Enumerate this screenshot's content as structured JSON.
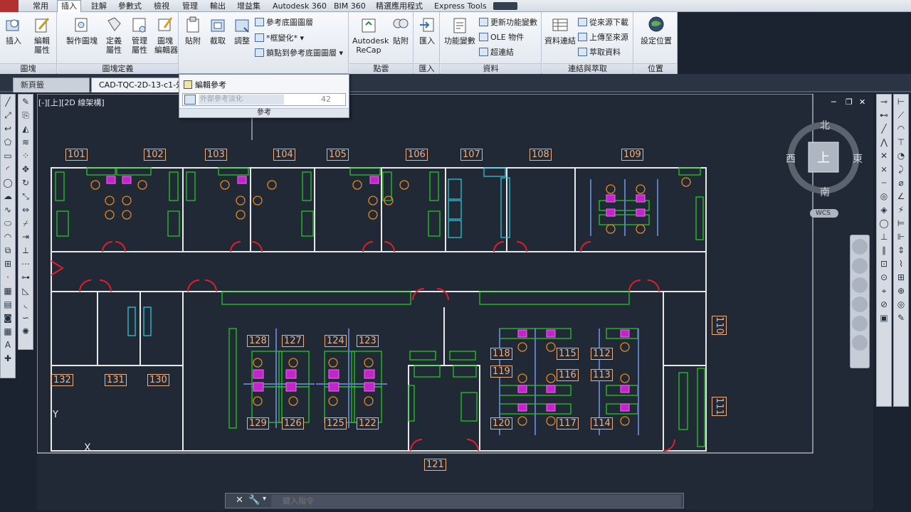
{
  "ribbon_tabs": [
    "常用",
    "插入",
    "註解",
    "參數式",
    "檢視",
    "管理",
    "輸出",
    "增益集",
    "Autodesk 360",
    "BIM 360",
    "精選應用程式",
    "Express Tools"
  ],
  "active_tab": "插入",
  "panels": {
    "block": {
      "title": "圖塊",
      "buttons": [
        "插入",
        "編輯\n屬性"
      ]
    },
    "block_def": {
      "title": "圖塊定義",
      "buttons": [
        "製作圖塊",
        "定義\n屬性",
        "管理\n屬性",
        "圖塊\n編輯器"
      ]
    },
    "reference": {
      "buttons": [
        "貼附",
        "截取",
        "調整"
      ],
      "small": [
        "參考底圖圖層",
        "*框變化*",
        "鎖點到參考底圖圖層"
      ]
    },
    "point_cloud": {
      "title": "點雲",
      "buttons": [
        "Autodesk\nReCap",
        "貼附"
      ]
    },
    "import": {
      "title": "匯入",
      "buttons": [
        "匯入"
      ]
    },
    "data": {
      "title": "資料",
      "buttons": [
        "功能變數"
      ],
      "small": [
        "更新功能變數",
        "OLE 物件",
        "超連結"
      ]
    },
    "link_extract": {
      "title": "連結與萃取",
      "buttons": [
        "資料連結"
      ],
      "small": [
        "從來源下載",
        "上傳至來源",
        "萃取資料"
      ]
    },
    "location": {
      "title": "位置",
      "buttons": [
        "設定位置"
      ]
    }
  },
  "dropdown": {
    "edit_ref": "編輯參考",
    "fade_label": "外部參考淡化",
    "fade_value": "42",
    "footer": "參考"
  },
  "doc_tabs": [
    "新頁籤",
    "CAD-TQC-2D-13-c1-外"
  ],
  "viewport_label": "[-][上][2D 線架構]",
  "viewcube": {
    "north": "北",
    "south": "南",
    "east": "東",
    "west": "西",
    "top": "上",
    "wcs": "WCS"
  },
  "rooms_top": [
    "101",
    "102",
    "103",
    "104",
    "105",
    "106",
    "107",
    "108",
    "109"
  ],
  "rooms_left": [
    "132",
    "131",
    "130"
  ],
  "rooms_center": [
    "128",
    "127",
    "124",
    "123",
    "129",
    "126",
    "125",
    "122"
  ],
  "rooms_right": [
    "118",
    "115",
    "112",
    "119",
    "116",
    "113",
    "120",
    "117",
    "114"
  ],
  "rooms_side": [
    "110",
    "111"
  ],
  "room_bottom": "121",
  "ucs": {
    "y": "Y",
    "x": "X"
  },
  "command": {
    "placeholder": "鍵入指令"
  }
}
